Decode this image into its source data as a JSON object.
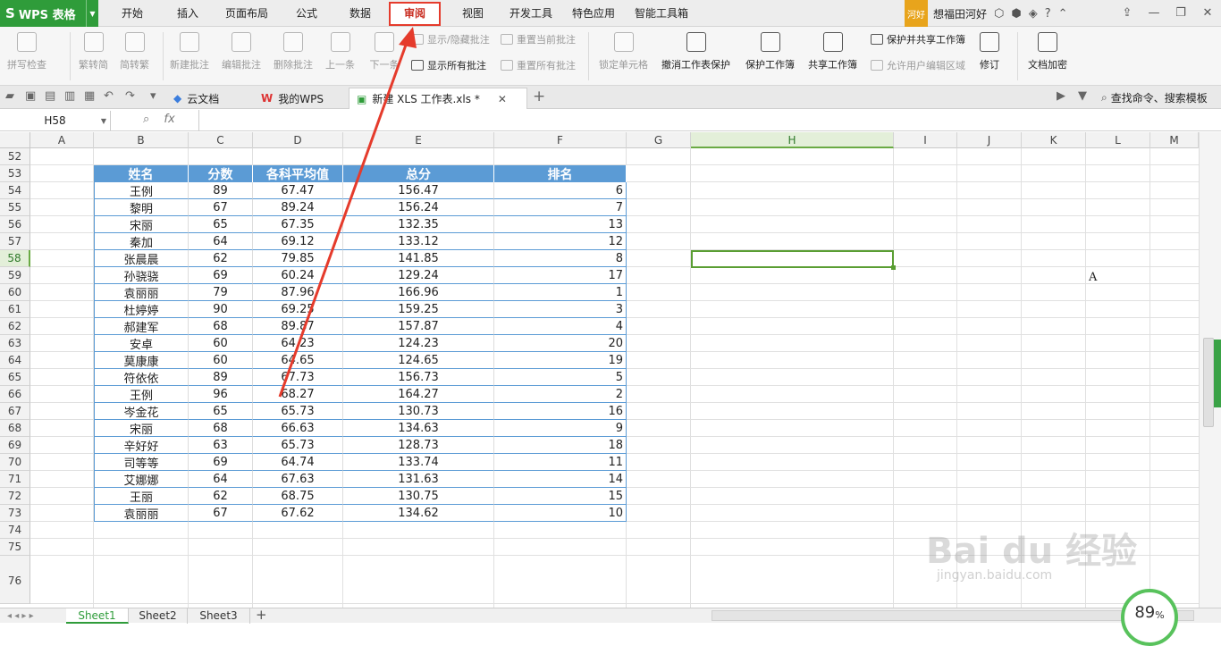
{
  "app": {
    "name": "WPS 表格"
  },
  "menu": {
    "items": [
      "开始",
      "插入",
      "页面布局",
      "公式",
      "数据",
      "审阅",
      "视图",
      "开发工具",
      "特色应用",
      "智能工具箱"
    ]
  },
  "user": {
    "badge": "河好",
    "name": "想福田河好"
  },
  "ribbon": {
    "spellcheck": "拼写检查",
    "to_traditional": "繁转简",
    "to_simplified": "简转繁",
    "new_comment": "新建批注",
    "edit_comment": "编辑批注",
    "delete_comment": "删除批注",
    "prev": "上一条",
    "next": "下一条",
    "show_hide_comment": "显示/隐藏批注",
    "show_all_comments": "显示所有批注",
    "reset_current_comment": "重置当前批注",
    "reset_all_comments": "重置所有批注",
    "lock_cell": "锁定单元格",
    "unprotect_sheet": "撤消工作表保护",
    "protect_workbook": "保护工作簿",
    "share_workbook": "共享工作簿",
    "protect_and_share": "保护并共享工作簿",
    "allow_edit_ranges": "允许用户编辑区域",
    "track_changes": "修订",
    "encrypt": "文档加密"
  },
  "doctabs": {
    "cloud": "云文档",
    "mywps": "我的WPS",
    "file": "新建 XLS 工作表.xls *",
    "search": "查找命令、搜索模板"
  },
  "formula": {
    "namebox": "H58",
    "fx": "fx"
  },
  "columns": [
    "A",
    "B",
    "C",
    "D",
    "E",
    "F",
    "G",
    "H",
    "I",
    "J",
    "K",
    "L",
    "M"
  ],
  "rows": [
    "52",
    "53",
    "54",
    "55",
    "56",
    "57",
    "58",
    "59",
    "60",
    "61",
    "62",
    "63",
    "64",
    "65",
    "66",
    "67",
    "68",
    "69",
    "70",
    "71",
    "72",
    "73",
    "74",
    "75",
    "76"
  ],
  "selected_cell": "H58",
  "table": {
    "headers": [
      "姓名",
      "分数",
      "各科平均值",
      "总分",
      "排名"
    ],
    "rows": [
      [
        "王例",
        "89",
        "67.47",
        "156.47",
        "6"
      ],
      [
        "黎明",
        "67",
        "89.24",
        "156.24",
        "7"
      ],
      [
        "宋丽",
        "65",
        "67.35",
        "132.35",
        "13"
      ],
      [
        "秦加",
        "64",
        "69.12",
        "133.12",
        "12"
      ],
      [
        "张晨晨",
        "62",
        "79.85",
        "141.85",
        "8"
      ],
      [
        "孙骁骁",
        "69",
        "60.24",
        "129.24",
        "17"
      ],
      [
        "袁丽丽",
        "79",
        "87.96",
        "166.96",
        "1"
      ],
      [
        "杜婷婷",
        "90",
        "69.25",
        "159.25",
        "3"
      ],
      [
        "郝建军",
        "68",
        "89.87",
        "157.87",
        "4"
      ],
      [
        "安卓",
        "60",
        "64.23",
        "124.23",
        "20"
      ],
      [
        "莫康康",
        "60",
        "64.65",
        "124.65",
        "19"
      ],
      [
        "符依依",
        "89",
        "67.73",
        "156.73",
        "5"
      ],
      [
        "王例",
        "96",
        "68.27",
        "164.27",
        "2"
      ],
      [
        "岑金花",
        "65",
        "65.73",
        "130.73",
        "16"
      ],
      [
        "宋丽",
        "68",
        "66.63",
        "134.63",
        "9"
      ],
      [
        "辛好好",
        "63",
        "65.73",
        "128.73",
        "18"
      ],
      [
        "司等等",
        "69",
        "64.74",
        "133.74",
        "11"
      ],
      [
        "艾娜娜",
        "64",
        "67.63",
        "131.63",
        "14"
      ],
      [
        "王丽",
        "62",
        "68.75",
        "130.75",
        "15"
      ],
      [
        "袁丽丽",
        "67",
        "67.62",
        "134.62",
        "10"
      ]
    ]
  },
  "cell_L59": "A",
  "sheets": [
    "Sheet1",
    "Sheet2",
    "Sheet3"
  ],
  "zoom": {
    "value": "89",
    "unit": "%"
  },
  "watermark": {
    "brand": "Bai du 经验",
    "site": "jingyan.baidu.com"
  },
  "colors": {
    "accent": "#2f9c3a",
    "table_header": "#5b9bd5",
    "table_border": "#5b9bd5",
    "annotation": "#e53b2c"
  }
}
